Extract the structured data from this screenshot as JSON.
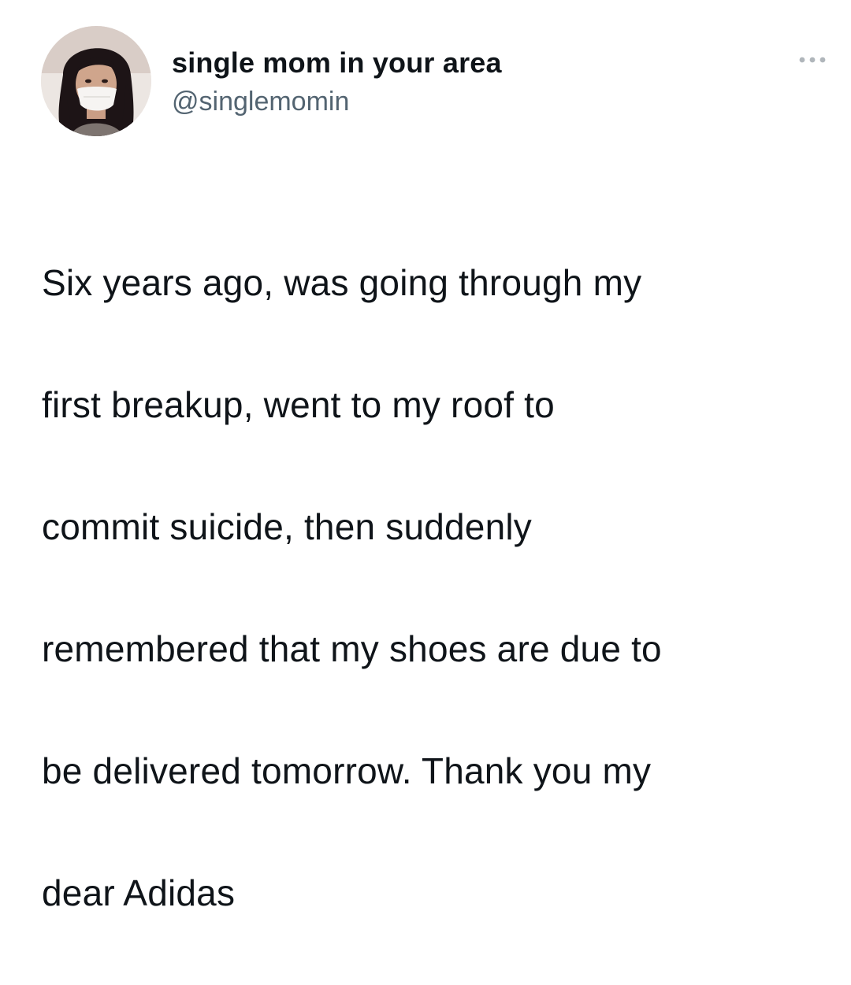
{
  "tweet": {
    "author": {
      "display_name": "single mom in your area",
      "handle": "@singlemomin"
    },
    "more_icon": "more-horizontal-icon",
    "text_lines": [
      "Six years ago, was going through my",
      "first breakup, went to my roof to",
      "commit suicide, then suddenly",
      "remembered that my shoes are due to",
      "be delivered tomorrow. Thank you my",
      "dear Adidas"
    ]
  },
  "colors": {
    "text": "#0f1419",
    "secondary_text": "#536471",
    "more_icon": "#b0b6bb"
  }
}
